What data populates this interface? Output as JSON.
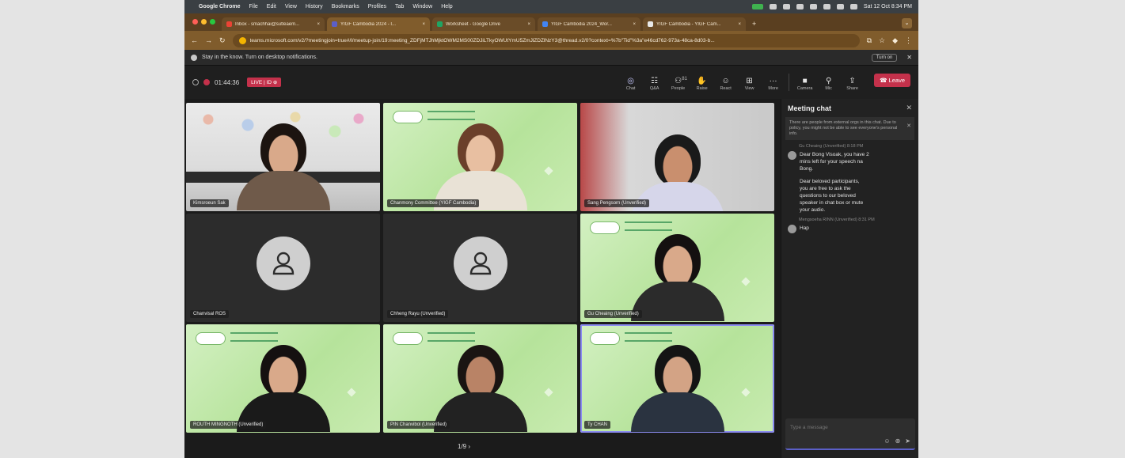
{
  "menubar": {
    "app": "Google Chrome",
    "items": [
      "File",
      "Edit",
      "View",
      "History",
      "Bookmarks",
      "Profiles",
      "Tab",
      "Window",
      "Help"
    ],
    "clock": "Sat 12 Oct 8:34 PM"
  },
  "tabs": [
    {
      "title": "Inbox - smachhai@sutleaem...",
      "icon": "gmail-icon"
    },
    {
      "title": "YIGF Cambodia 2024 - I...",
      "icon": "teams-icon",
      "active": true
    },
    {
      "title": "Worksheet - Google Drive",
      "icon": "drive-icon"
    },
    {
      "title": "YIGF Cambodia 2024_Wor...",
      "icon": "doc-icon"
    },
    {
      "title": "YIGF Cambodia - YIGF Cam...",
      "icon": "globe-icon"
    }
  ],
  "address": {
    "url": "teams.microsoft.com/v2/?meetingjoin=true#/l/meetup-join/19:meeting_ZDFjMTJhMjktOWM2MS00ZDJiLTkyOWUtYmU5ZmJlZDZlNzY3@thread.v2/0?context=%7b\"Tid\"%3a\"e46cd762-973a-48ca-8d03-b..."
  },
  "banner": {
    "text": "Stay in the know. Turn on desktop notifications.",
    "button": "Turn on"
  },
  "meeting": {
    "timer": "01:44:36",
    "live": "LIVE | ID ⊕",
    "controls": [
      {
        "label": "Chat",
        "icon": "chat-icon",
        "glyph": "◎",
        "active": true
      },
      {
        "label": "Q&A",
        "icon": "qa-icon",
        "glyph": "☷"
      },
      {
        "label": "People",
        "icon": "people-icon",
        "glyph": "⚇",
        "count": "81"
      },
      {
        "label": "Raise",
        "icon": "raise-hand-icon",
        "glyph": "✋"
      },
      {
        "label": "React",
        "icon": "react-icon",
        "glyph": "☺"
      },
      {
        "label": "View",
        "icon": "view-icon",
        "glyph": "⊞"
      },
      {
        "label": "More",
        "icon": "more-icon",
        "glyph": "···"
      },
      {
        "label": "Camera",
        "icon": "camera-icon",
        "glyph": "■"
      },
      {
        "label": "Mic",
        "icon": "mic-icon",
        "glyph": "⚲"
      },
      {
        "label": "Share",
        "icon": "share-icon",
        "glyph": "⇪"
      }
    ],
    "leave": "Leave"
  },
  "participants": [
    {
      "name": "Kimsroeun Sak",
      "bg": "wall"
    },
    {
      "name": "Chanmony Committee (YIGF Cambodia)",
      "bg": "green"
    },
    {
      "name": "Sang Pengsorn (Unverified)",
      "bg": "office"
    },
    {
      "name": "Chanvisal ROS",
      "bg": "grey"
    },
    {
      "name": "Chheng Rayu (Unverified)",
      "bg": "grey"
    },
    {
      "name": "Gu Cheaing (Unverified)",
      "bg": "green"
    },
    {
      "name": "ROUTH MINGNOTH (Unverified)",
      "bg": "green"
    },
    {
      "name": "PIN Chanvibol (Unverified)",
      "bg": "green"
    },
    {
      "name": "Ty CHAN",
      "bg": "green",
      "selected": true
    }
  ],
  "pager": "1/9 ›",
  "chat": {
    "title": "Meeting chat",
    "warning": "There are people from external orgs in this chat. Due to policy, you might not be able to see everyone's personal info.",
    "messages": [
      {
        "sender": "Gu Cheaing (Unverified)",
        "time": "8:18 PM",
        "lines": [
          "Dear Bong Visoak, you have 2",
          "mins left for your speech na",
          "Bong.",
          "",
          "Dear beloved participants,",
          "you are free to ask the",
          "questions to our beloved",
          "speaker in chat box or mute",
          "your audio."
        ]
      },
      {
        "sender": "Mengsoeha RINN (Unverified)",
        "time": "8:31 PM",
        "lines": [
          "Hap"
        ]
      }
    ],
    "placeholder": "Type a message"
  }
}
